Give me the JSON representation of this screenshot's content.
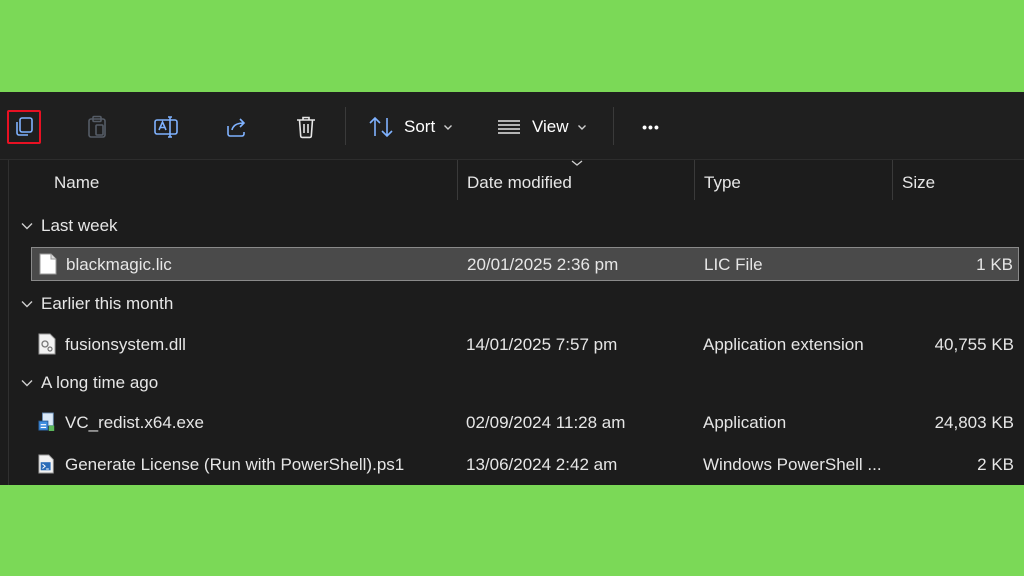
{
  "toolbar": {
    "sort_label": "Sort",
    "view_label": "View",
    "more_label": "•••"
  },
  "columns": {
    "name": "Name",
    "date_modified": "Date modified",
    "type": "Type",
    "size": "Size"
  },
  "groups": [
    {
      "label": "Last week",
      "files": [
        {
          "name": "blackmagic.lic",
          "date": "20/01/2025 2:36 pm",
          "type": "LIC File",
          "size": "1 KB",
          "icon": "document-icon",
          "selected": true
        }
      ]
    },
    {
      "label": "Earlier this month",
      "files": [
        {
          "name": "fusionsystem.dll",
          "date": "14/01/2025 7:57 pm",
          "type": "Application extension",
          "size": "40,755 KB",
          "icon": "dll-icon"
        }
      ]
    },
    {
      "label": "A long time ago",
      "files": [
        {
          "name": "VC_redist.x64.exe",
          "date": "02/09/2024 11:28 am",
          "type": "Application",
          "size": "24,803 KB",
          "icon": "installer-icon"
        },
        {
          "name": "Generate License (Run with PowerShell).ps1",
          "date": "13/06/2024 2:42 am",
          "type": "Windows PowerShell ...",
          "size": "2 KB",
          "icon": "powershell-script-icon"
        }
      ]
    }
  ],
  "colors": {
    "background": "#7bd957",
    "window": "#1c1c1c",
    "highlight": "#e81123",
    "selection": "#4a4a4a"
  }
}
